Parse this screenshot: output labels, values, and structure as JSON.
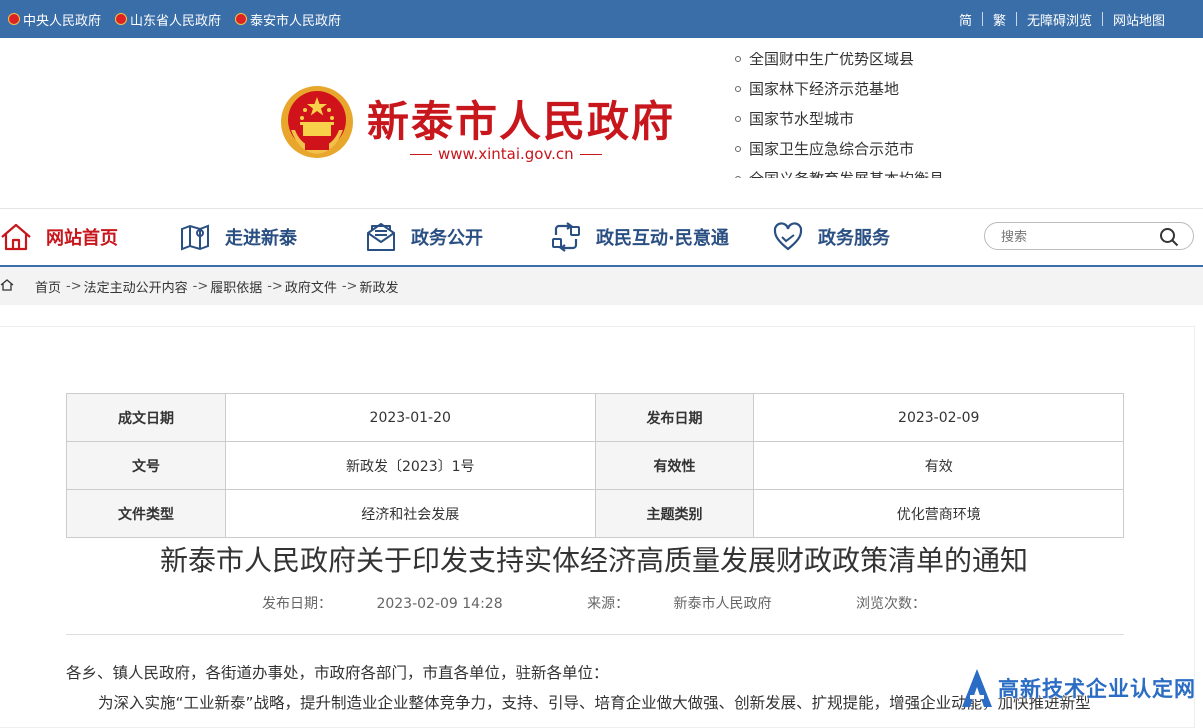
{
  "topbar": {
    "links": [
      "中央人民政府",
      "山东省人民政府",
      "泰安市人民政府"
    ],
    "right": [
      "简",
      "繁",
      "无障碍浏览",
      "网站地图"
    ]
  },
  "header": {
    "title": "新泰市人民政府",
    "url": "www.xintai.gov.cn",
    "honors": [
      "全国财中生广优势区域县",
      "国家林下经济示范基地",
      "国家节水型城市",
      "国家卫生应急综合示范市",
      "全国义务教育发展基本均衡县"
    ]
  },
  "nav": {
    "items": [
      "网站首页",
      "走进新泰",
      "政务公开",
      "政民互动·民意通",
      "政务服务"
    ],
    "search_placeholder": "搜索"
  },
  "breadcrumb": [
    "首页",
    "法定主动公开内容",
    "履职依据",
    "政府文件",
    "新政发"
  ],
  "meta": [
    [
      "成文日期",
      "2023-01-20",
      "发布日期",
      "2023-02-09"
    ],
    [
      "文号",
      "新政发〔2023〕1号",
      "有效性",
      "有效"
    ],
    [
      "文件类型",
      "经济和社会发展",
      "主题类别",
      "优化营商环境"
    ]
  ],
  "doc": {
    "title": "新泰市人民政府关于印发支持实体经济高质量发展财政政策清单的通知",
    "publish_label": "发布日期：",
    "publish_value": "2023-02-09 14:28",
    "source_label": "来源：",
    "source_value": "新泰市人民政府",
    "views_label": "浏览次数：",
    "para1": "各乡、镇人民政府，各街道办事处，市政府各部门，市直各单位，驻新各单位：",
    "para2": "为深入实施“工业新泰”战略，提升制造业企业整体竞争力，支持、引导、培育企业做大做强、创新发展、扩规提能，增强企业动能，加快推进新型"
  },
  "watermark": "高新技术企业认定网",
  "colors": {
    "topbar": "#3a6ea8",
    "brand_red": "#c8161d",
    "nav_blue": "#2a4f82"
  }
}
